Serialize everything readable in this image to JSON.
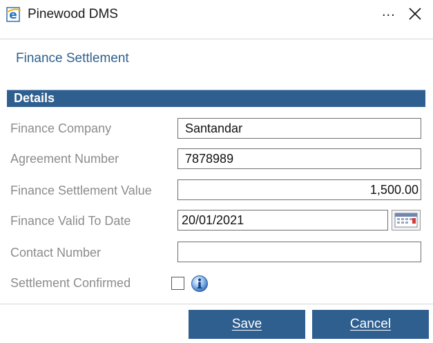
{
  "window": {
    "title": "Pinewood DMS",
    "app_icon": "ie-icon",
    "more_label": "...",
    "close_icon": "close-icon"
  },
  "form": {
    "title": "Finance Settlement",
    "section_title": "Details",
    "fields": {
      "finance_company": {
        "label": "Finance Company",
        "value": "Santandar"
      },
      "agreement_number": {
        "label": "Agreement Number",
        "value": "7878989"
      },
      "settlement_value": {
        "label": "Finance Settlement Value",
        "value": "1,500.00"
      },
      "valid_to_date": {
        "label": "Finance Valid To Date",
        "value": "20/01/2021"
      },
      "contact_number": {
        "label": "Contact Number",
        "value": ""
      },
      "settlement_confirmed": {
        "label": "Settlement Confirmed",
        "checked": false
      }
    }
  },
  "buttons": {
    "save_label": "Save",
    "cancel_label": "Cancel"
  },
  "colors": {
    "accent": "#2f5f8f",
    "label": "#8c8c8c"
  }
}
